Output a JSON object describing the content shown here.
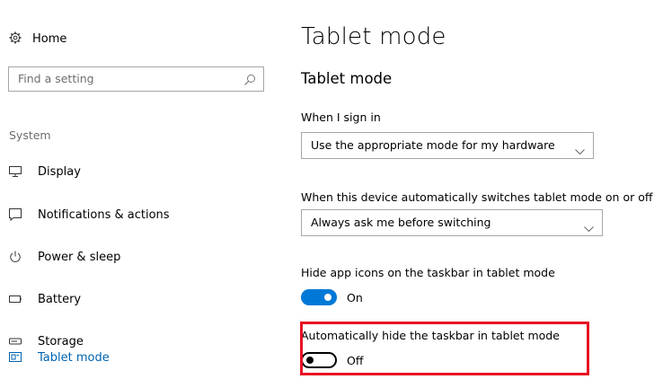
{
  "sidebar": {
    "home_label": "Home",
    "search_placeholder": "Find a setting",
    "group_label": "System",
    "items": [
      {
        "label": "Display",
        "icon": "display-icon"
      },
      {
        "label": "Notifications & actions",
        "icon": "notifications-icon"
      },
      {
        "label": "Power & sleep",
        "icon": "power-icon"
      },
      {
        "label": "Battery",
        "icon": "battery-icon"
      },
      {
        "label": "Storage",
        "icon": "storage-icon"
      },
      {
        "label": "Tablet mode",
        "icon": "tablet-mode-icon",
        "active": true
      }
    ]
  },
  "main": {
    "page_title": "Tablet mode",
    "section_title": "Tablet mode",
    "sign_in": {
      "label": "When I sign in",
      "value": "Use the appropriate mode for my hardware"
    },
    "auto_switch": {
      "label": "When this device automatically switches tablet mode on or off",
      "value": "Always ask me before switching"
    },
    "hide_icons": {
      "label": "Hide app icons on the taskbar in tablet mode",
      "state": "On",
      "on": true
    },
    "hide_taskbar": {
      "label": "Automatically hide the taskbar in tablet mode",
      "state": "Off",
      "on": false
    }
  },
  "colors": {
    "accent": "#0078d7",
    "active_nav": "#0063b1",
    "highlight": "#e81123"
  }
}
